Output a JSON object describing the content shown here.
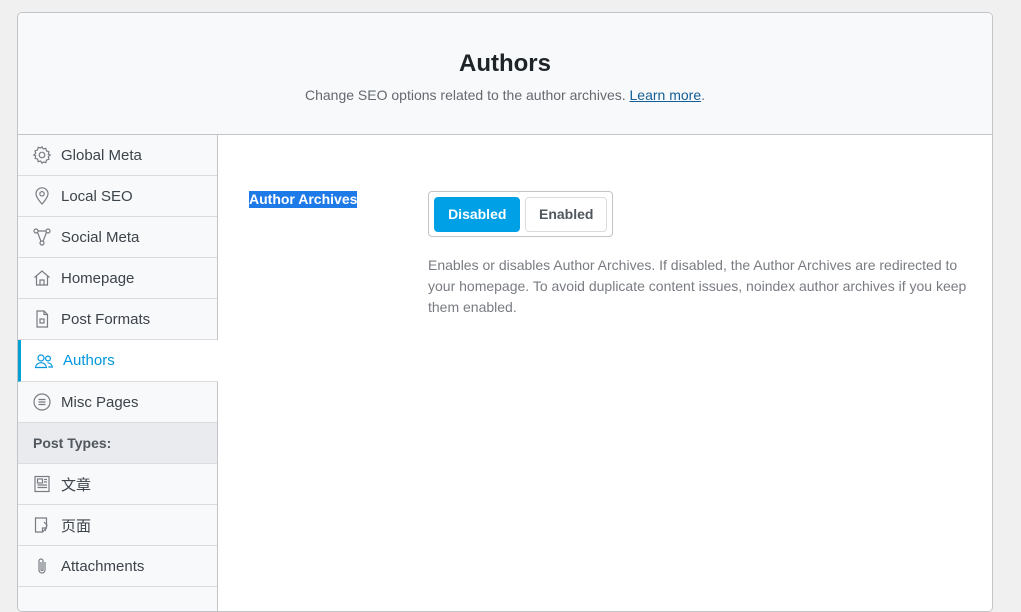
{
  "header": {
    "title": "Authors",
    "subtitle": "Change SEO options related to the author archives.",
    "learn_more": "Learn more",
    "subtitle_end": "."
  },
  "sidebar": {
    "items": [
      {
        "label": "Global Meta",
        "icon": "gear-icon"
      },
      {
        "label": "Local SEO",
        "icon": "map-pin-icon"
      },
      {
        "label": "Social Meta",
        "icon": "share-nodes-icon"
      },
      {
        "label": "Homepage",
        "icon": "home-icon"
      },
      {
        "label": "Post Formats",
        "icon": "document-icon"
      },
      {
        "label": "Authors",
        "icon": "users-icon",
        "active": true
      },
      {
        "label": "Misc Pages",
        "icon": "list-circle-icon"
      }
    ],
    "section_label": "Post Types:",
    "post_types": [
      {
        "label": "文章",
        "icon": "post-icon"
      },
      {
        "label": "页面",
        "icon": "page-icon"
      },
      {
        "label": "Attachments",
        "icon": "paperclip-icon"
      }
    ]
  },
  "setting": {
    "label": "Author Archives",
    "options": [
      "Disabled",
      "Enabled"
    ],
    "selected": "Disabled",
    "description": "Enables or disables Author Archives. If disabled, the Author Archives are redirected to your homepage. To avoid duplicate content issues, noindex author archives if you keep them enabled."
  },
  "colors": {
    "accent": "#00a0e6",
    "active_nav": "#0096dd",
    "label_highlight": "#1e7ae6"
  }
}
